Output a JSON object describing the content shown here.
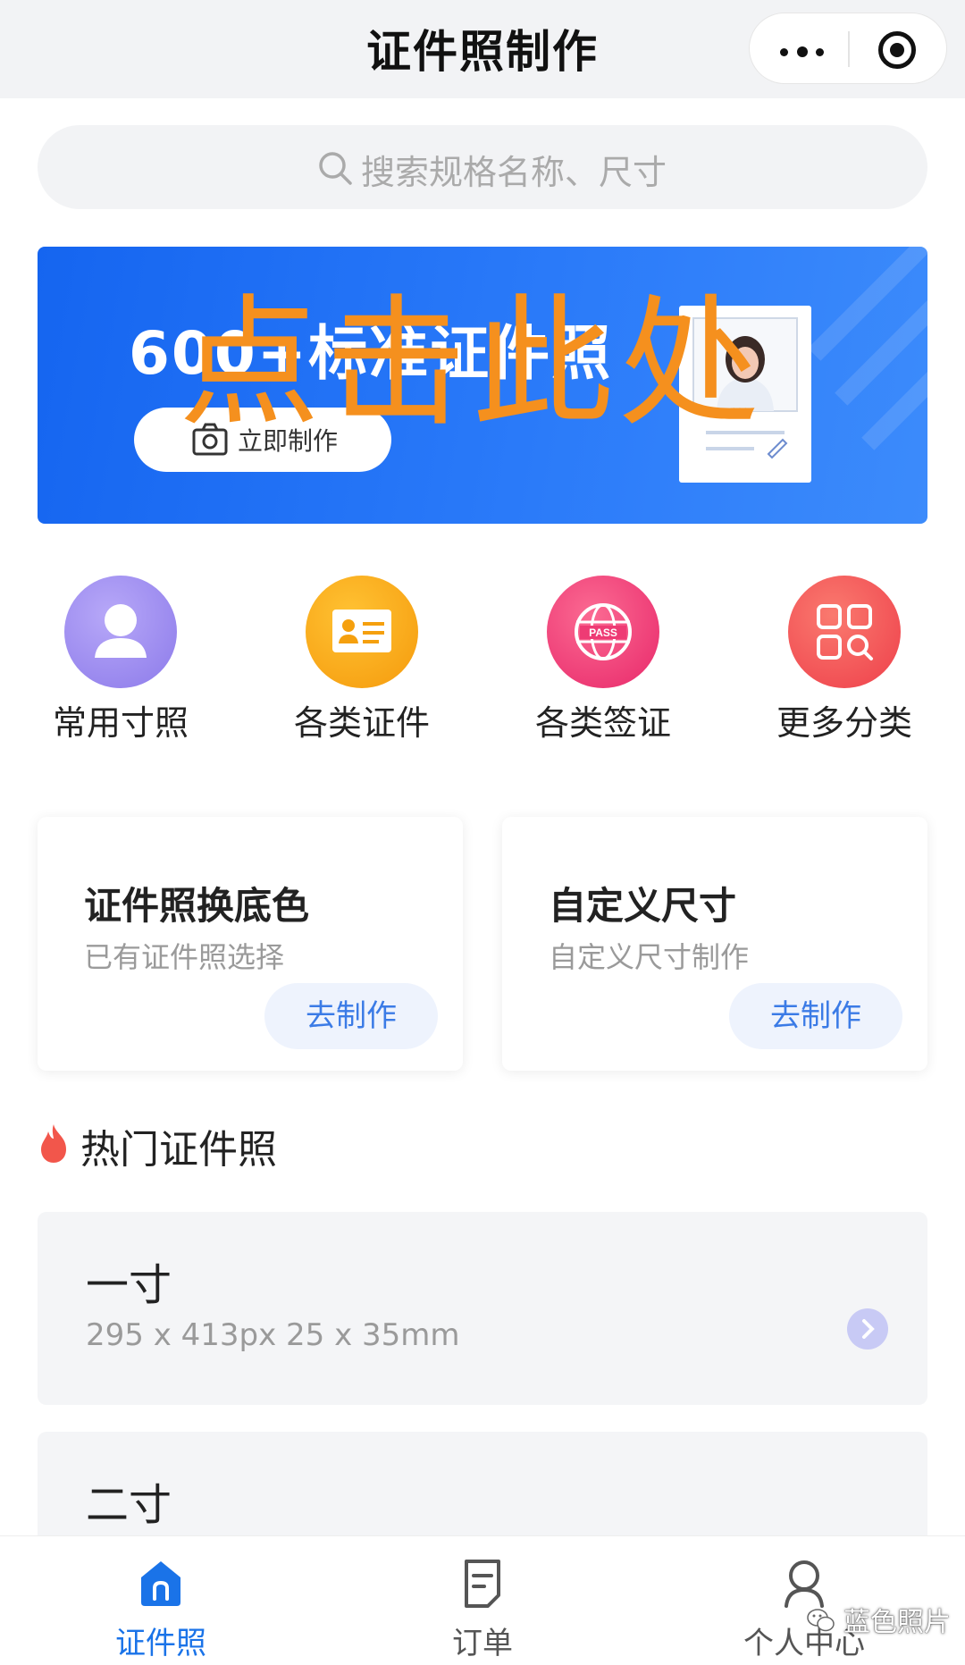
{
  "nav": {
    "title": "证件照制作",
    "more_icon": "more-dots-icon",
    "close_icon": "target-circle-icon"
  },
  "search": {
    "placeholder": "搜索规格名称、尺寸",
    "icon": "search-icon"
  },
  "banner": {
    "title": "600+标准证件照",
    "button_label": "立即制作",
    "overlay_text": "点击此处",
    "accent": "#1565f0",
    "overlay_color": "#f5901e"
  },
  "categories": [
    {
      "label": "常用寸照",
      "icon": "person-icon",
      "color": "#9b8cf0"
    },
    {
      "label": "各类证件",
      "icon": "id-card-icon",
      "color": "#fba414"
    },
    {
      "label": "各类签证",
      "icon": "passport-globe-icon",
      "color": "#f2437a"
    },
    {
      "label": "更多分类",
      "icon": "grid-search-icon",
      "color": "#f4545a"
    }
  ],
  "features": [
    {
      "title": "证件照换底色",
      "subtitle": "已有证件照选择",
      "button": "去制作"
    },
    {
      "title": "自定义尺寸",
      "subtitle": "自定义尺寸制作",
      "button": "去制作"
    }
  ],
  "hot": {
    "title": "热门证件照",
    "icon": "fire-icon",
    "items": [
      {
        "name": "一寸",
        "dims": "295 x 413px  25 x 35mm"
      },
      {
        "name": "二寸",
        "dims": ""
      }
    ]
  },
  "tabs": [
    {
      "label": "证件照",
      "icon": "home-icon",
      "active": true
    },
    {
      "label": "订单",
      "icon": "order-icon",
      "active": false
    },
    {
      "label": "个人中心",
      "icon": "user-icon",
      "active": false
    }
  ],
  "watermark": {
    "text": "蓝色照片",
    "icon": "wechat-icon"
  },
  "colors": {
    "primary": "#1a73e8",
    "inactive": "#555555"
  }
}
